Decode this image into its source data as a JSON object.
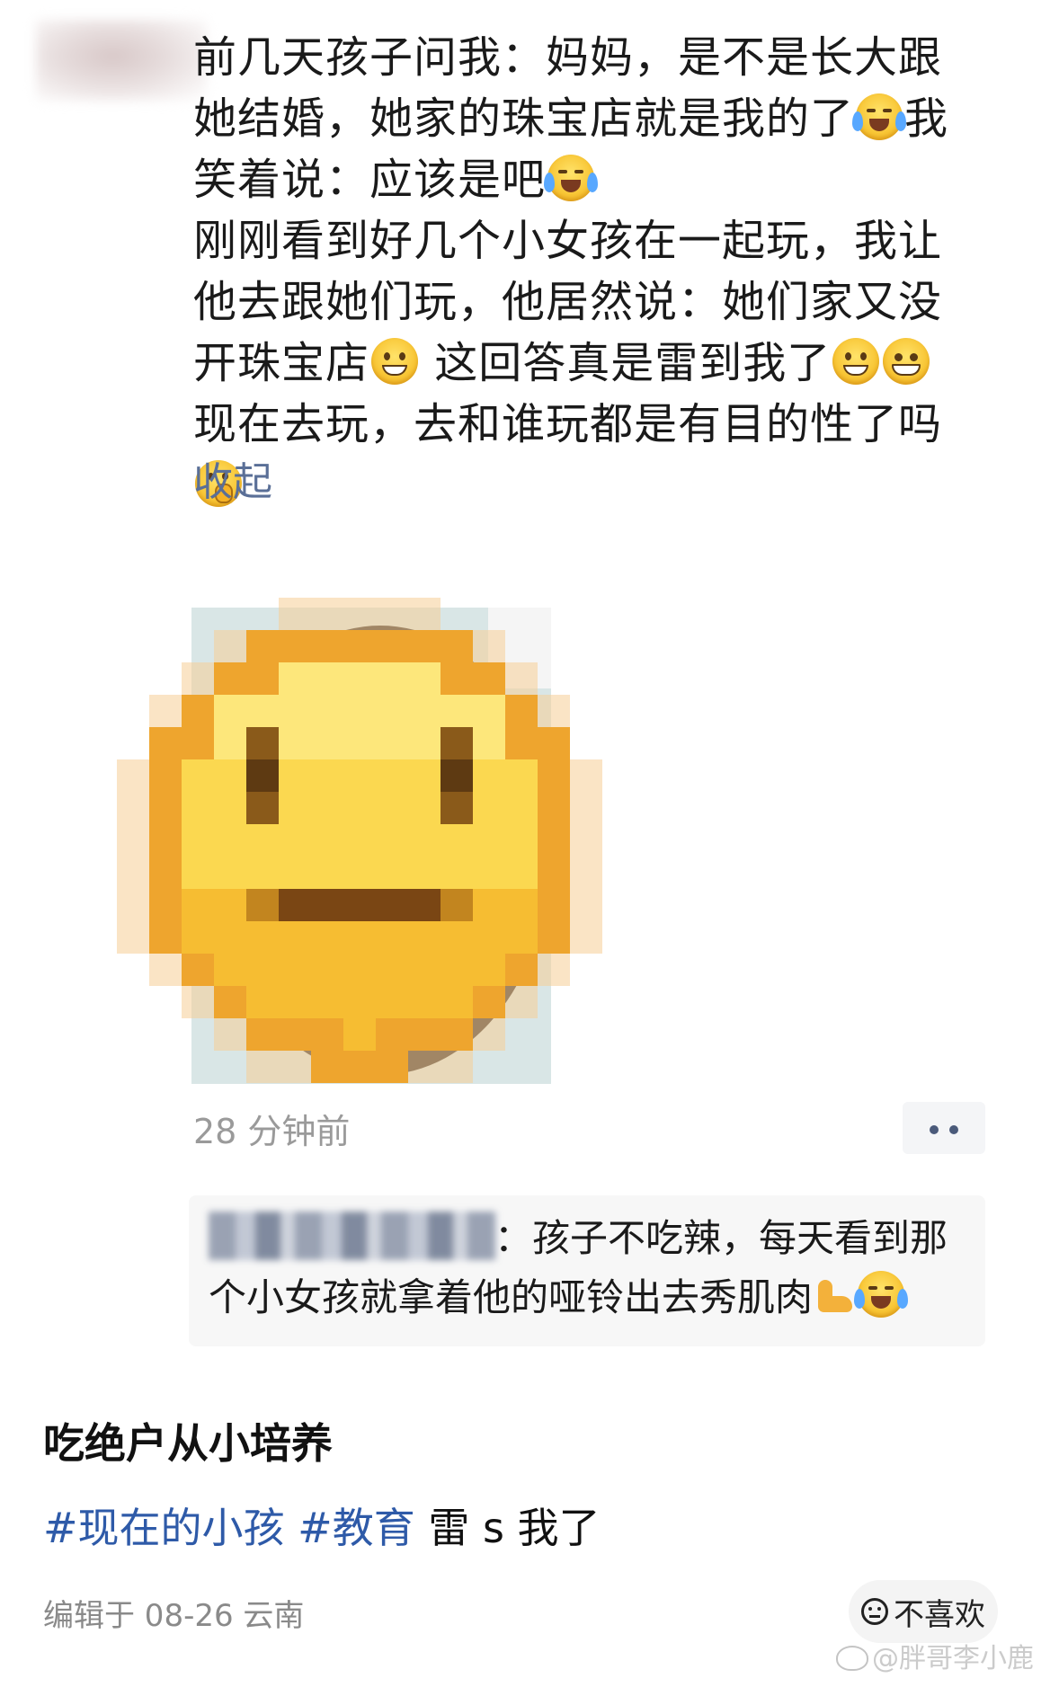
{
  "post": {
    "lines": [
      "前几天孩子问我：妈妈，是不是长大跟",
      "她结婚，她家的珠宝店就是我的了",
      "我",
      "笑着说：应该是吧",
      "刚刚看到好几个小女孩在一起玩，我让",
      "他去跟她们玩，他居然说：她们家又没",
      "开珠宝店",
      " 这回答真是雷到我了",
      "现在去玩，去和谁玩都是有目的性了吗"
    ],
    "collapse_label": "收起",
    "timestamp": "28 分钟前"
  },
  "comment": {
    "separator": "：",
    "line1": "孩子不吃辣，每天看到那",
    "line2": "个小女孩就拿着他的哑铃出去秀肌肉"
  },
  "caption": "吃绝户从小培养",
  "hashtags": {
    "tag1": "#现在的小孩",
    "tag2": "#教育",
    "plain": "雷 s 我了"
  },
  "edit_info": "编辑于 08-26 云南",
  "dislike_label": "不喜欢",
  "watermark": "@胖哥李小鹿",
  "colors": {
    "link": "#5a6f97",
    "hashtag": "#2e5aa8",
    "meta_text": "#9a9a9a"
  },
  "icons": [
    "laugh-cry-emoji",
    "grin-emoji",
    "beam-emoji",
    "thinking-emoji",
    "muscle-emoji",
    "more-dots-icon",
    "dislike-face-icon",
    "weibo-logo-icon"
  ]
}
